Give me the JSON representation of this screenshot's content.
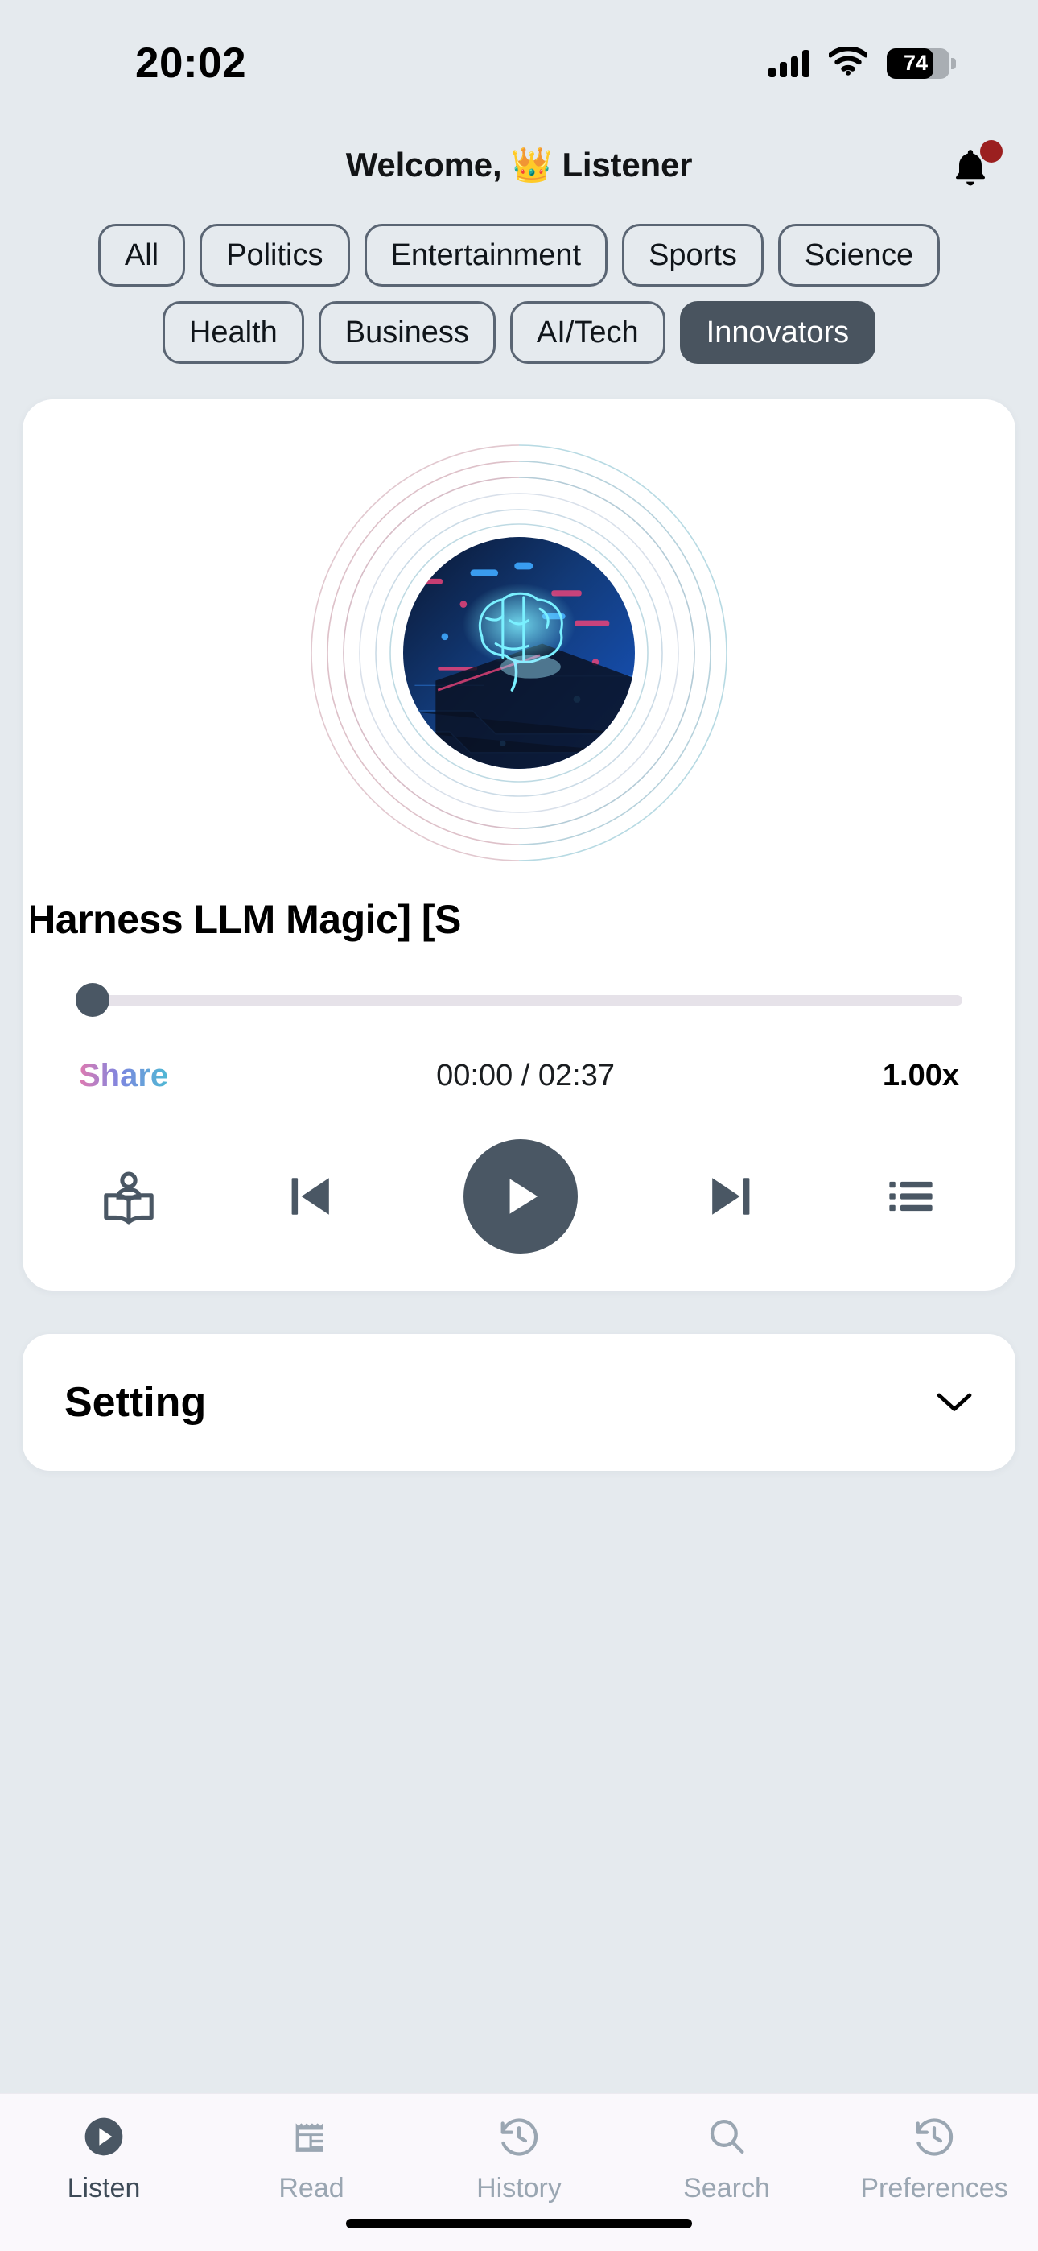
{
  "status_bar": {
    "time": "20:02",
    "signal_icon": "cellular-signal-icon",
    "wifi_icon": "wifi-icon",
    "battery_percent": "74",
    "battery_icon": "battery-icon"
  },
  "header": {
    "greeting": "Welcome, 👑 Listener",
    "notification_icon": "bell-icon",
    "has_unread_badge": true,
    "badge_color": "#9b1f1f"
  },
  "categories": {
    "row1": [
      {
        "label": "All",
        "active": false
      },
      {
        "label": "Politics",
        "active": false
      },
      {
        "label": "Entertainment",
        "active": false
      },
      {
        "label": "Sports",
        "active": false
      },
      {
        "label": "Science",
        "active": false
      }
    ],
    "row2": [
      {
        "label": "Health",
        "active": false
      },
      {
        "label": "Business",
        "active": false
      },
      {
        "label": "AI/Tech",
        "active": false
      },
      {
        "label": "Innovators",
        "active": true
      }
    ],
    "active_color": "#49545f",
    "border_color": "#5a6573"
  },
  "player": {
    "artwork_icon": "ai-brain-circuit-artwork",
    "title": "rtphones Harness LLM Magic]   [S",
    "progress_percent": 0,
    "share_label": "Share",
    "time_display": "00:00 / 02:37",
    "current_time": "00:00",
    "total_time": "02:37",
    "speed_label": "1.00x",
    "accent_color": "#4a5764",
    "track_color": "#e6e2e9",
    "controls": [
      {
        "name": "reader-icon",
        "label": "Reader"
      },
      {
        "name": "previous-track-icon",
        "label": "Previous"
      },
      {
        "name": "play-icon",
        "label": "Play"
      },
      {
        "name": "next-track-icon",
        "label": "Next"
      },
      {
        "name": "playlist-icon",
        "label": "Playlist"
      }
    ]
  },
  "setting": {
    "label": "Setting",
    "chevron_icon": "chevron-down-icon",
    "expanded": false
  },
  "tabbar": {
    "items": [
      {
        "label": "Listen",
        "icon": "play-circle-icon",
        "active": true
      },
      {
        "label": "Read",
        "icon": "newspaper-icon",
        "active": false
      },
      {
        "label": "History",
        "icon": "clock-rewind-icon",
        "active": false
      },
      {
        "label": "Search",
        "icon": "search-icon",
        "active": false
      },
      {
        "label": "Preferences",
        "icon": "clock-rewind-icon",
        "active": false
      }
    ],
    "active_color": "#3d4a57",
    "inactive_color": "#9aa6b2",
    "background": "#faf8fc"
  },
  "colors": {
    "page_background": "#e5eaee",
    "card_background": "#ffffff",
    "text_primary": "#000000"
  }
}
